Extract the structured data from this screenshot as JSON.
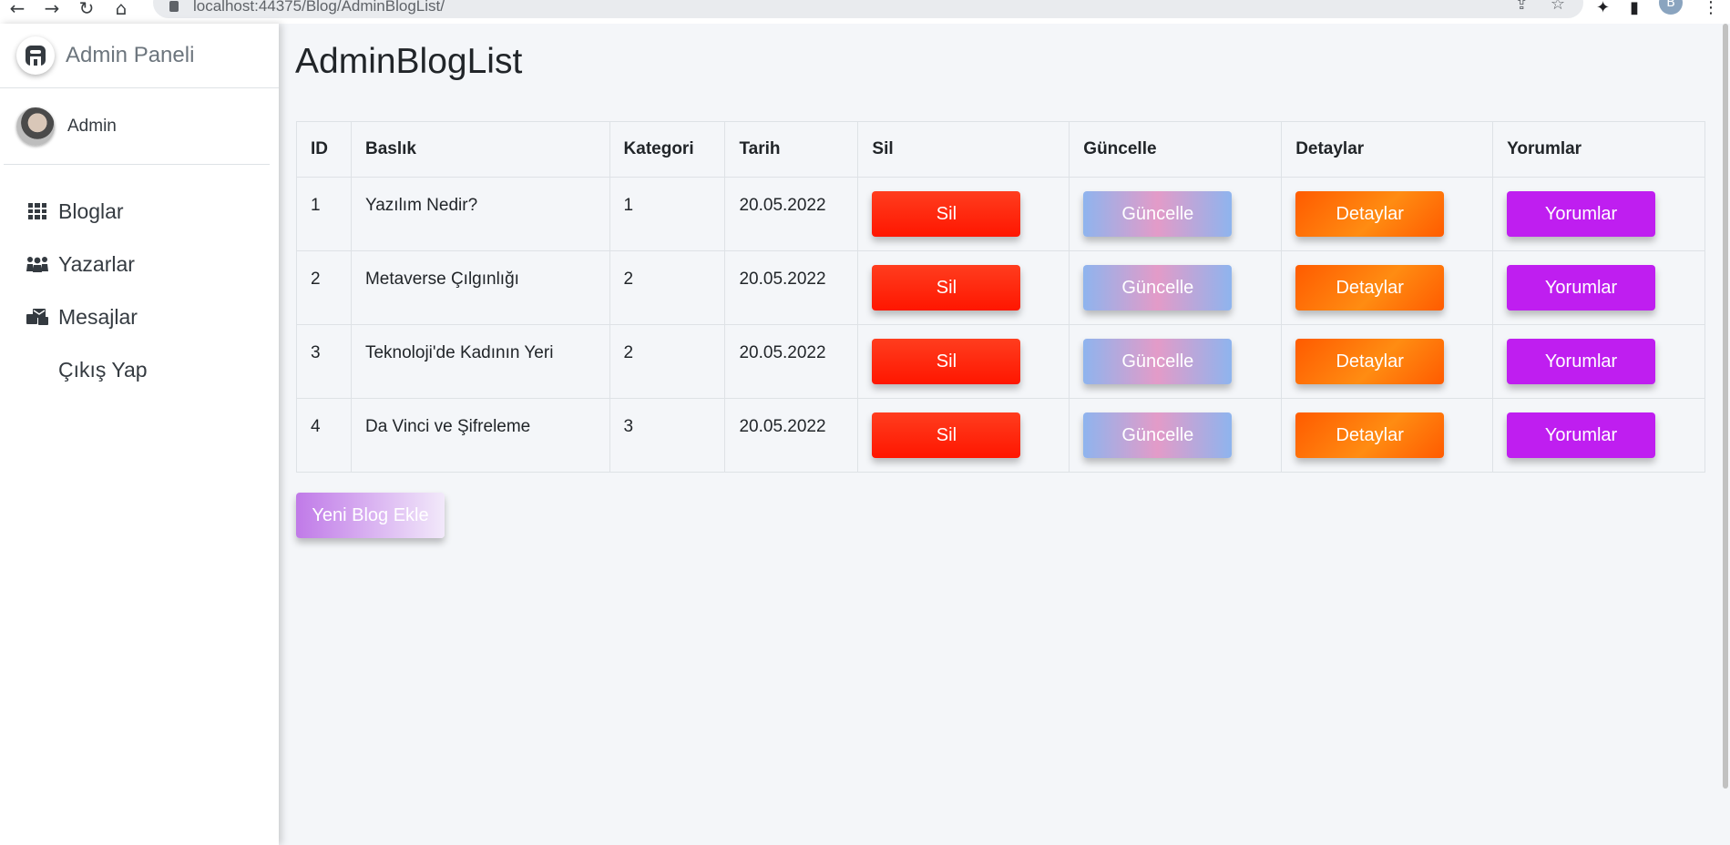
{
  "browser": {
    "url": "localhost:44375/Blog/AdminBlogList/",
    "profile_initial": "B"
  },
  "sidebar": {
    "brand": "Admin Paneli",
    "user": "Admin",
    "items": [
      {
        "label": "Bloglar",
        "icon": "grid-icon"
      },
      {
        "label": "Yazarlar",
        "icon": "users-icon"
      },
      {
        "label": "Mesajlar",
        "icon": "mail-bulk-icon"
      },
      {
        "label": "Çıkış Yap",
        "icon": ""
      }
    ]
  },
  "main": {
    "title": "AdminBlogList",
    "columns": [
      "ID",
      "Baslık",
      "Kategori",
      "Tarih",
      "Sil",
      "Güncelle",
      "Detaylar",
      "Yorumlar"
    ],
    "rows": [
      {
        "id": "1",
        "title": "Yazılım Nedir?",
        "category": "1",
        "date": "20.05.2022"
      },
      {
        "id": "2",
        "title": "Metaverse Çılgınlığı",
        "category": "2",
        "date": "20.05.2022"
      },
      {
        "id": "3",
        "title": "Teknoloji'de Kadının Yeri",
        "category": "2",
        "date": "20.05.2022"
      },
      {
        "id": "4",
        "title": "Da Vinci ve Şifreleme",
        "category": "3",
        "date": "20.05.2022"
      }
    ],
    "buttons": {
      "delete": "Sil",
      "update": "Güncelle",
      "details": "Detaylar",
      "comments": "Yorumlar"
    },
    "new_blog_button": "Yeni Blog Ekle"
  }
}
